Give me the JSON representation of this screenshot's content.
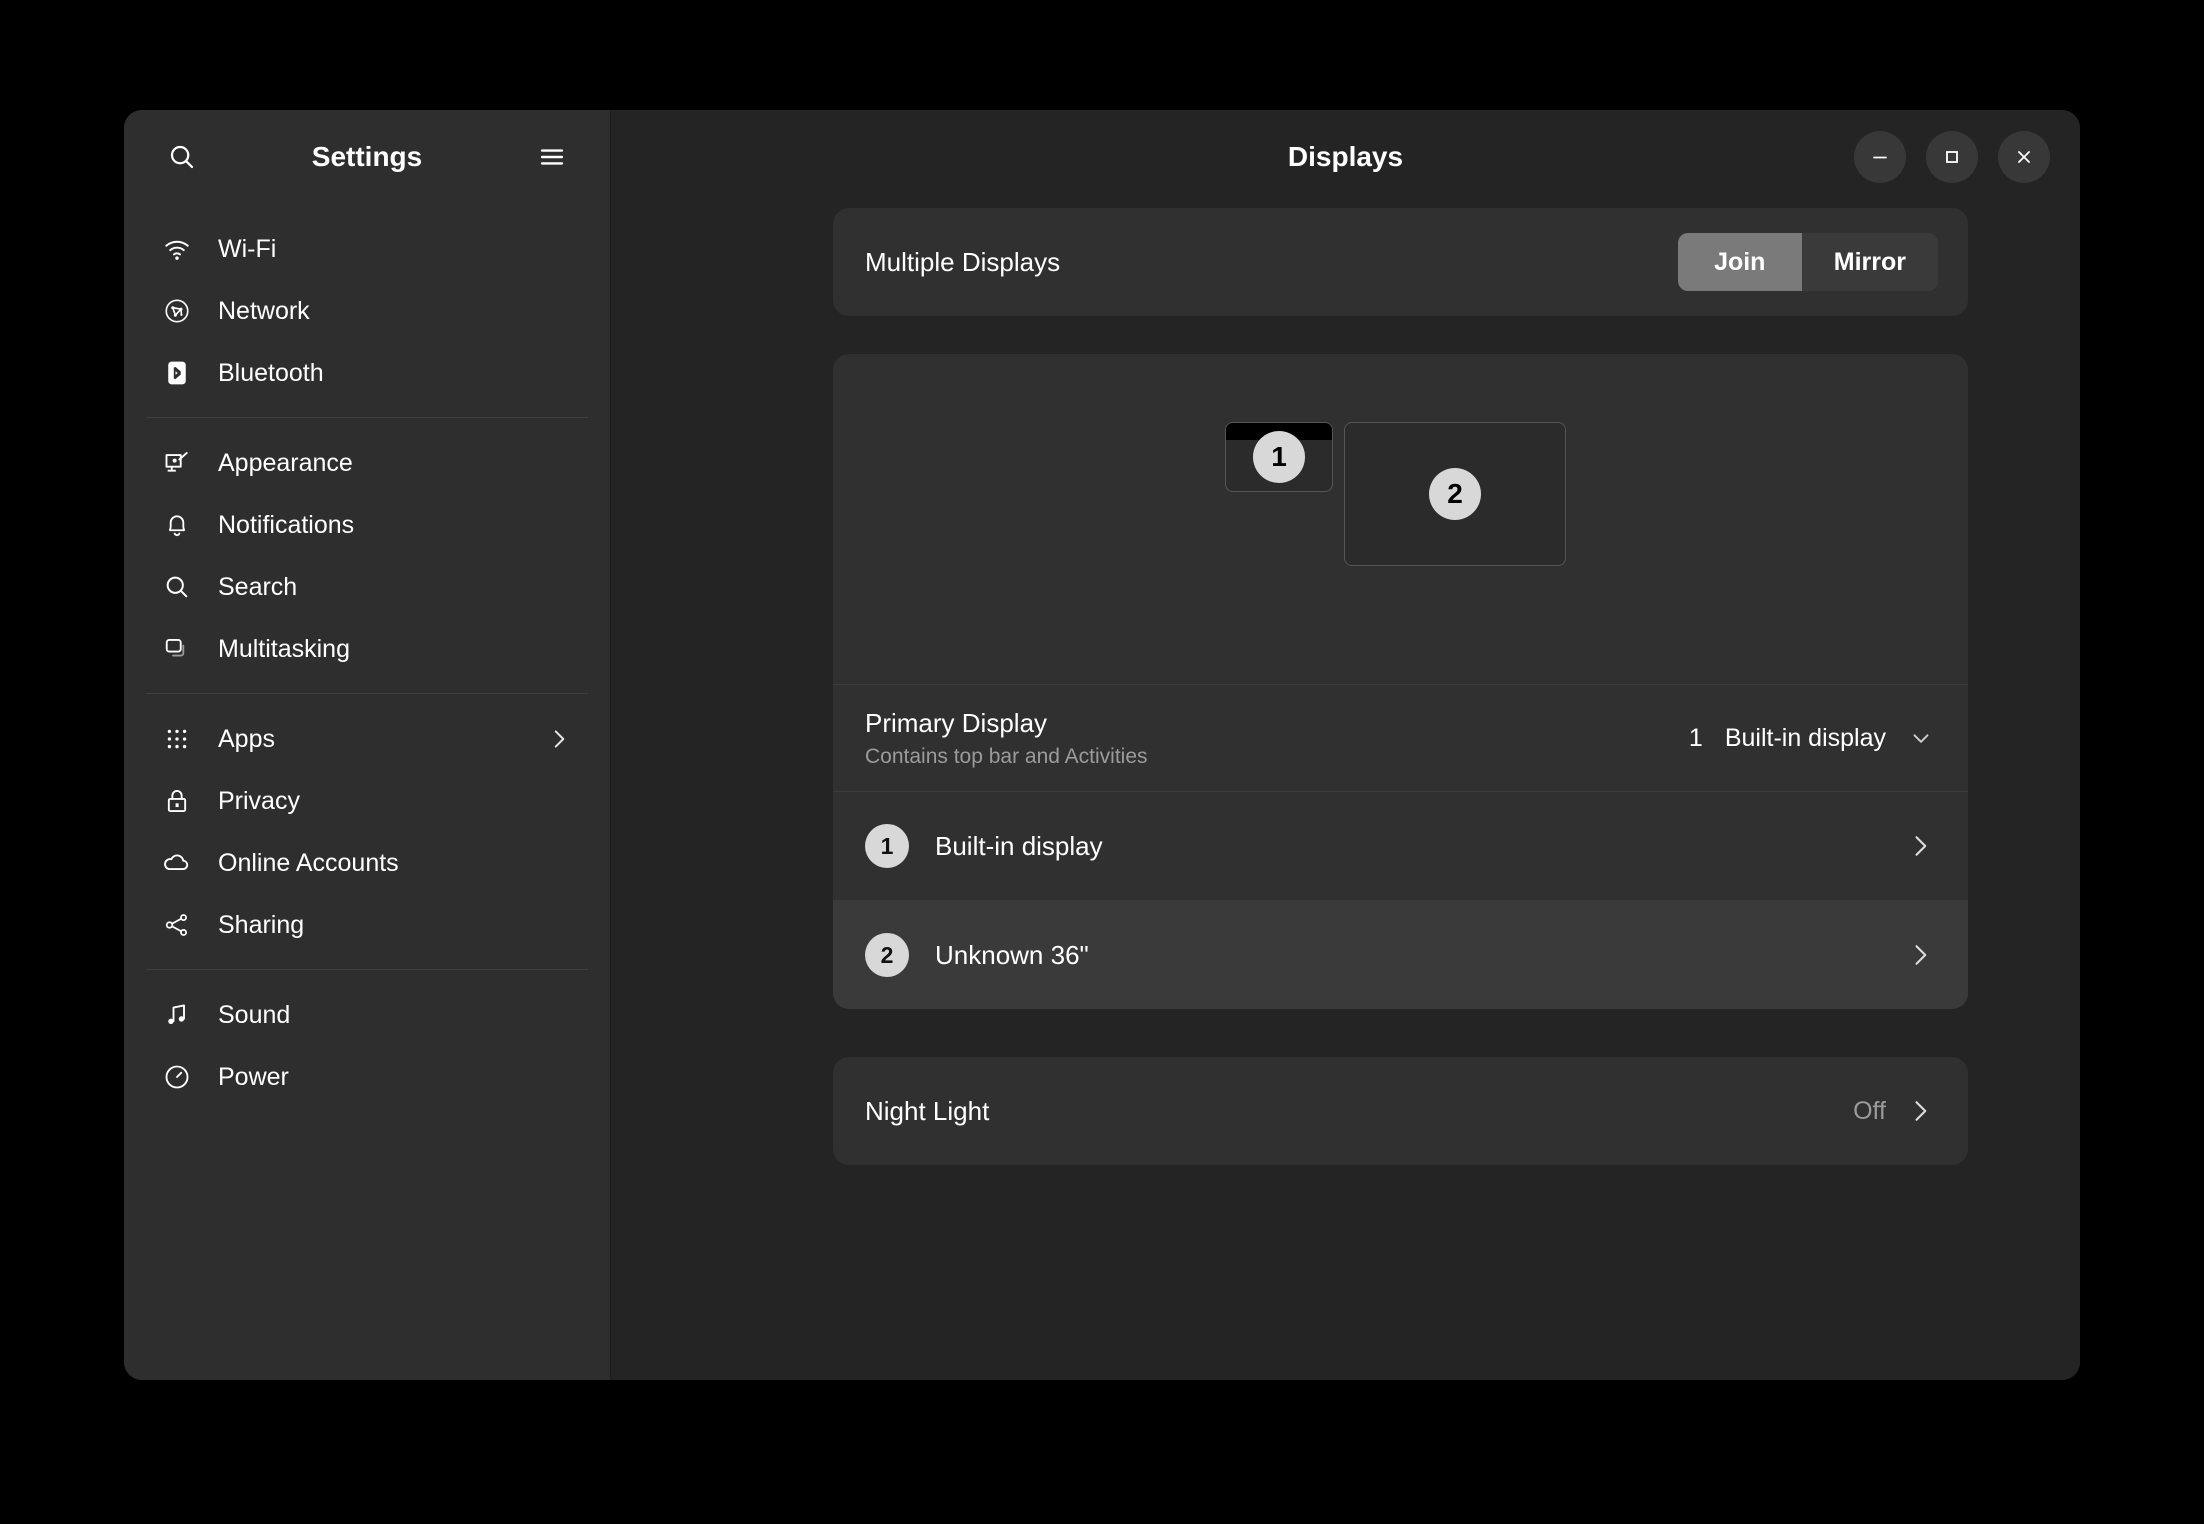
{
  "sidebar": {
    "title": "Settings",
    "search_icon": "search-icon",
    "menu_icon": "hamburger-menu-icon",
    "groups": [
      {
        "items": [
          {
            "label": "Wi-Fi",
            "icon": "wifi-icon"
          },
          {
            "label": "Network",
            "icon": "network-icon"
          },
          {
            "label": "Bluetooth",
            "icon": "bluetooth-icon"
          }
        ]
      },
      {
        "items": [
          {
            "label": "Appearance",
            "icon": "appearance-icon"
          },
          {
            "label": "Notifications",
            "icon": "bell-icon"
          },
          {
            "label": "Search",
            "icon": "search-icon"
          },
          {
            "label": "Multitasking",
            "icon": "multitasking-icon"
          }
        ]
      },
      {
        "items": [
          {
            "label": "Apps",
            "icon": "grid-icon",
            "chevron": true
          },
          {
            "label": "Privacy",
            "icon": "lock-icon"
          },
          {
            "label": "Online Accounts",
            "icon": "cloud-icon"
          },
          {
            "label": "Sharing",
            "icon": "share-icon"
          }
        ]
      },
      {
        "items": [
          {
            "label": "Sound",
            "icon": "music-note-icon"
          },
          {
            "label": "Power",
            "icon": "power-icon"
          }
        ]
      }
    ]
  },
  "header": {
    "title": "Displays",
    "minimize_label": "–",
    "maximize_label": "□",
    "close_label": "✕"
  },
  "multiple_displays": {
    "label": "Multiple Displays",
    "options": [
      {
        "label": "Join",
        "selected": true
      },
      {
        "label": "Mirror",
        "selected": false
      }
    ]
  },
  "arrangement": {
    "monitors": [
      {
        "badge": "1",
        "name": "Built-in display",
        "has_topbar": true
      },
      {
        "badge": "2",
        "name": "Unknown 36\"",
        "has_topbar": false
      }
    ]
  },
  "primary_display": {
    "title": "Primary Display",
    "subtitle": "Contains top bar and Activities",
    "value_number": "1",
    "value_label": "Built-in display",
    "chevron_icon": "chevron-down-icon"
  },
  "displays": [
    {
      "badge": "1",
      "name": "Built-in display",
      "chevron_icon": "chevron-right-icon",
      "hover": false
    },
    {
      "badge": "2",
      "name": "Unknown 36\"",
      "chevron_icon": "chevron-right-icon",
      "hover": true
    }
  ],
  "night_light": {
    "label": "Night Light",
    "state": "Off",
    "chevron_icon": "chevron-right-icon"
  },
  "colors": {
    "window_bg": "#242424",
    "sidebar_bg": "#2e2e2e",
    "card_bg": "#303030",
    "segment_active": "#7a7a7a",
    "badge_bg": "#d8d8d8",
    "muted_text": "#9b9b9b"
  }
}
